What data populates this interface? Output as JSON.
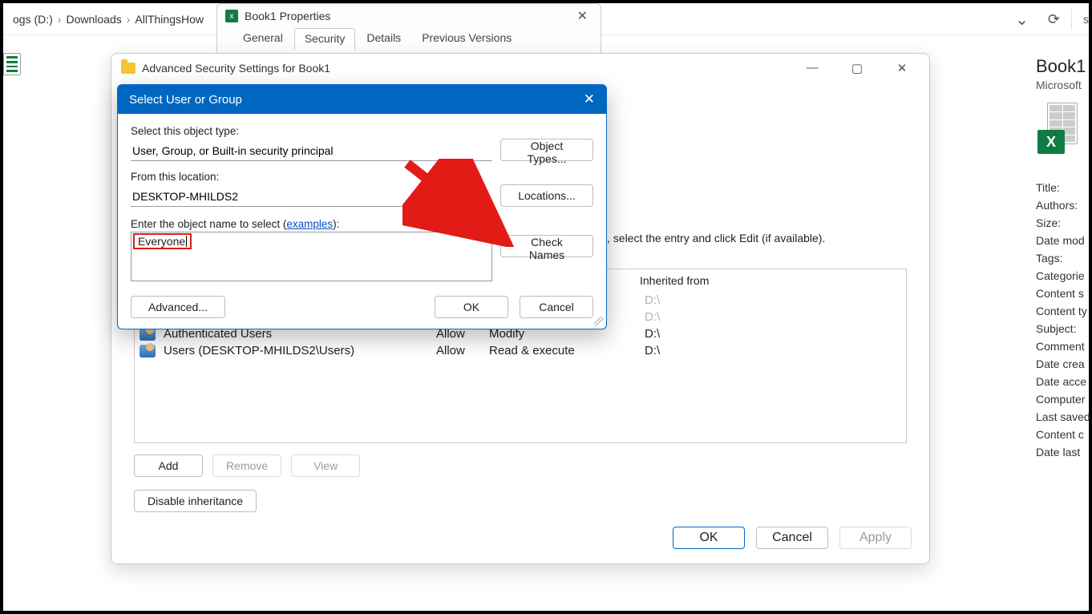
{
  "breadcrumbs": [
    "ogs (D:)",
    "Downloads",
    "AllThingsHow"
  ],
  "toolbar": {
    "search_icon": "s"
  },
  "properties_dialog": {
    "title": "Book1 Properties",
    "tabs": [
      "General",
      "Security",
      "Details",
      "Previous Versions"
    ],
    "active_tab_index": 1
  },
  "advanced": {
    "title": "Advanced Security Settings for Book1",
    "hint": ", select the entry and click Edit (if available).",
    "columns": {
      "inherited": "Inherited from"
    },
    "entries": [
      {
        "principal": "Authenticated Users",
        "type": "Allow",
        "access": "Modify",
        "inherited": "D:\\"
      },
      {
        "principal": "Users (DESKTOP-MHILDS2\\Users)",
        "type": "Allow",
        "access": "Read & execute",
        "inherited": "D:\\"
      }
    ],
    "extra_inherited": [
      "D:\\",
      "D:\\"
    ],
    "buttons": {
      "add": "Add",
      "remove": "Remove",
      "view": "View",
      "disable": "Disable inheritance",
      "ok": "OK",
      "cancel": "Cancel",
      "apply": "Apply"
    }
  },
  "select_dialog": {
    "title": "Select User or Group",
    "object_type_label": "Select this object type:",
    "object_type_value": "User, Group, or Built-in security principal",
    "location_label": "From this location:",
    "location_value": "DESKTOP-MHILDS2",
    "name_label_pre": "Enter the object name to select (",
    "name_label_link": "examples",
    "name_label_post": "):",
    "name_value": "Everyone",
    "buttons": {
      "object_types": "Object Types...",
      "locations": "Locations...",
      "check": "Check Names",
      "advanced": "Advanced...",
      "ok": "OK",
      "cancel": "Cancel"
    }
  },
  "side_panel": {
    "title": "Book1",
    "subtitle": "Microsoft",
    "excel_mark": "X",
    "props": [
      "Title:",
      "Authors:",
      "Size:",
      "Date mod",
      "Tags:",
      "Categorie",
      "Content s",
      "Content ty",
      "Subject:",
      "Comment",
      "Date crea",
      "Date acce",
      "Computer",
      "Last saved",
      "Content c",
      "Date last"
    ]
  }
}
